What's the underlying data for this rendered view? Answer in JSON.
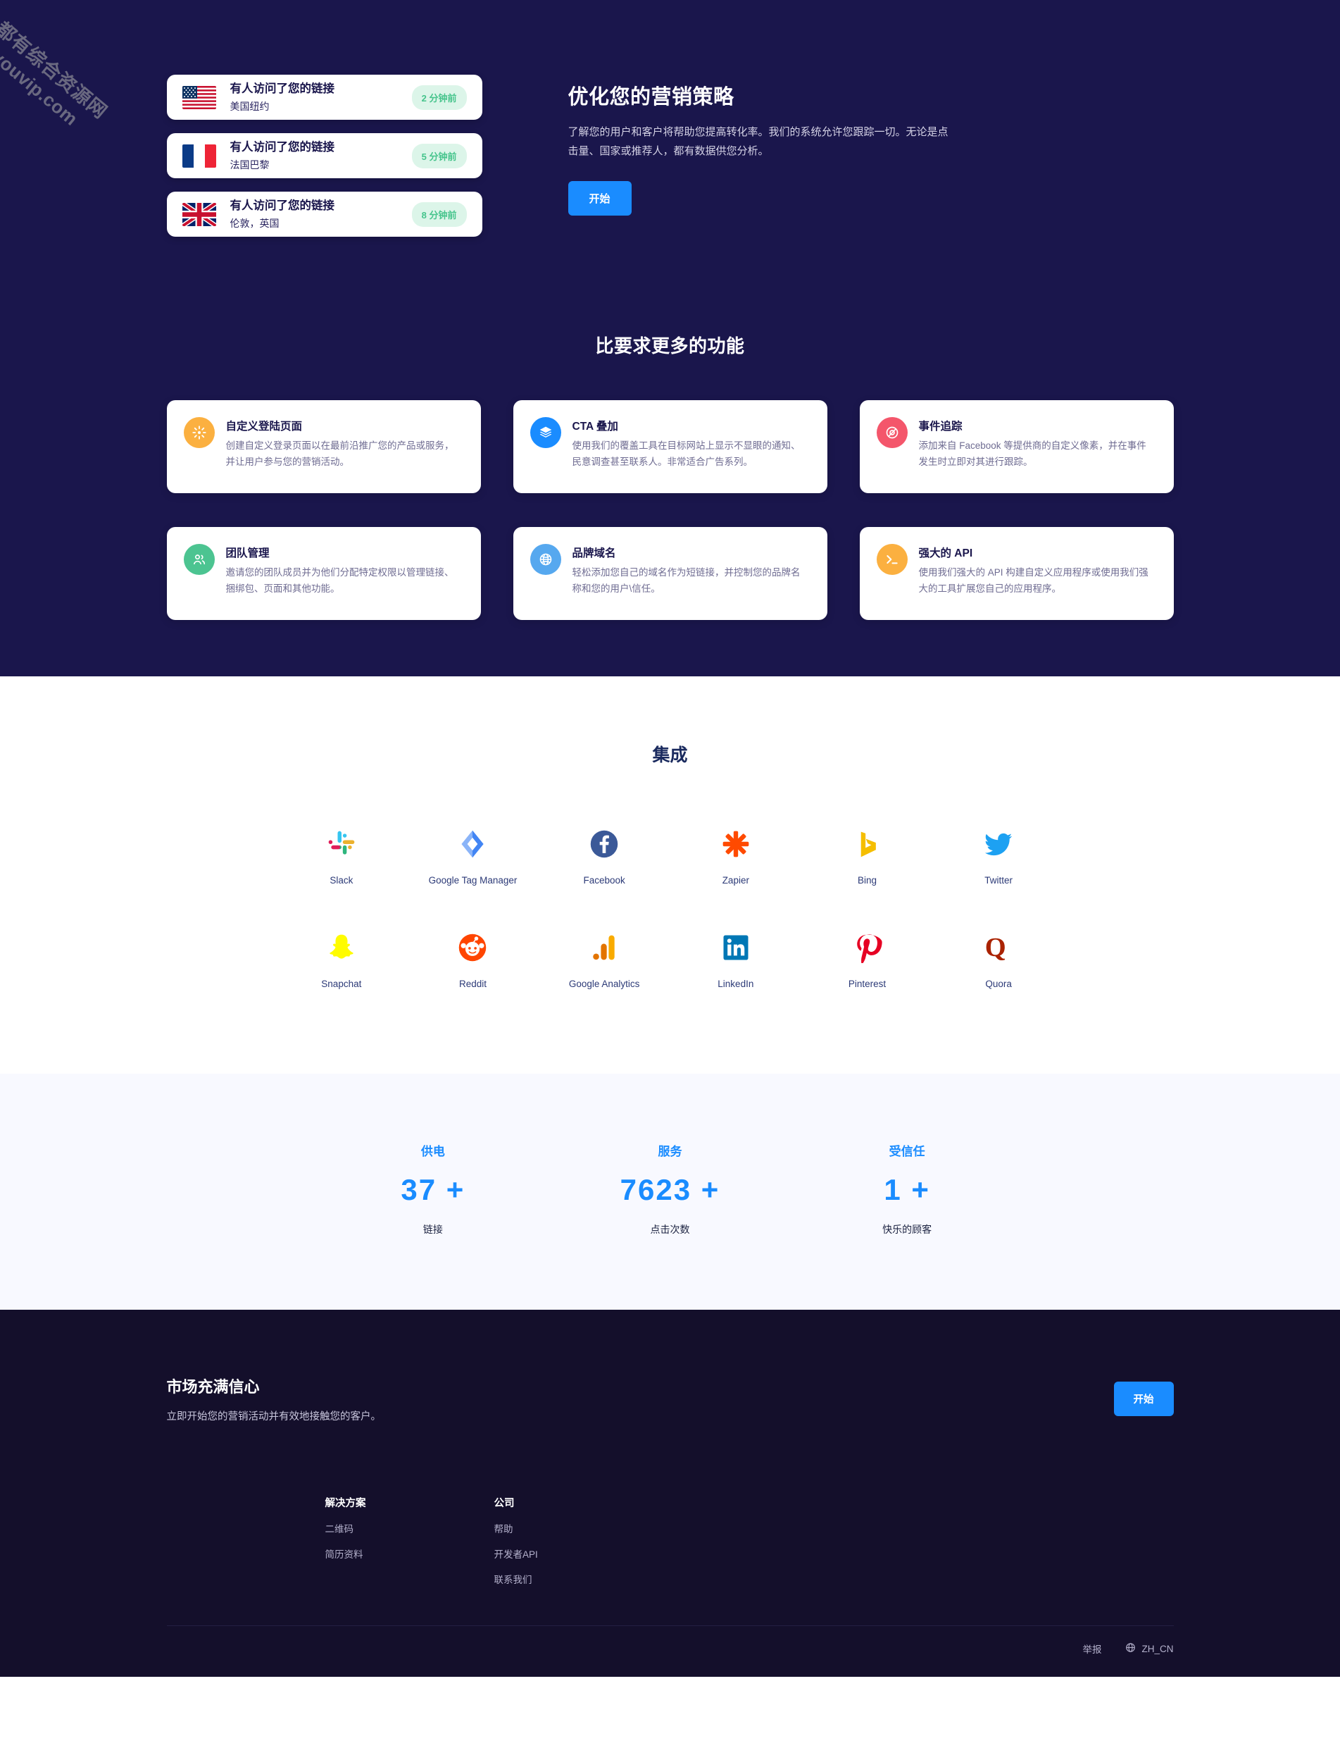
{
  "watermark": {
    "cn": "全都有综合资源网",
    "en": "douyouvip.com"
  },
  "hero": {
    "notifications": [
      {
        "flag": "us-flag",
        "title": "有人访问了您的链接",
        "location": "美国纽约",
        "time": "2 分钟前"
      },
      {
        "flag": "fr-flag",
        "title": "有人访问了您的链接",
        "location": "法国巴黎",
        "time": "5 分钟前"
      },
      {
        "flag": "gb-flag",
        "title": "有人访问了您的链接",
        "location": "伦敦，英国",
        "time": "8 分钟前"
      }
    ],
    "heading": "优化您的营销策略",
    "paragraph": "了解您的用户和客户将帮助您提高转化率。我们的系统允许您跟踪一切。无论是点击量、国家或推荐人，都有数据供您分析。",
    "cta_label": "开始"
  },
  "features": {
    "title": "比要求更多的功能",
    "cards": [
      {
        "icon": "sun-spinner-icon",
        "color": "#fbb040",
        "title": "自定义登陆页面",
        "desc": "创建自定义登录页面以在最前沿推广您的产品或服务，并让用户参与您的营销活动。"
      },
      {
        "icon": "layers-icon",
        "color": "#1a8cff",
        "title": "CTA 叠加",
        "desc": "使用我们的覆盖工具在目标网站上显示不显眼的通知、民意调查甚至联系人。非常适合广告系列。"
      },
      {
        "icon": "target-slash-icon",
        "color": "#f4566b",
        "title": "事件追踪",
        "desc": "添加来自 Facebook 等提供商的自定义像素，并在事件发生时立即对其进行跟踪。"
      },
      {
        "icon": "users-icon",
        "color": "#4cc491",
        "title": "团队管理",
        "desc": "邀请您的团队成员并为他们分配特定权限以管理链接、捆绑包、页面和其他功能。"
      },
      {
        "icon": "globe-icon",
        "color": "#56a8ef",
        "title": "品牌域名",
        "desc": "轻松添加您自己的域名作为短链接，并控制您的品牌名称和您的用户\\信任。"
      },
      {
        "icon": "terminal-icon",
        "color": "#fbb040",
        "title": "强大的 API",
        "desc": "使用我们强大的 API 构建自定义应用程序或使用我们强大的工具扩展您自己的应用程序。"
      }
    ]
  },
  "integrations": {
    "title": "集成",
    "items": [
      {
        "icon": "slack-icon",
        "label": "Slack"
      },
      {
        "icon": "google-tag-manager-icon",
        "label": "Google Tag Manager"
      },
      {
        "icon": "facebook-icon",
        "label": "Facebook"
      },
      {
        "icon": "zapier-icon",
        "label": "Zapier"
      },
      {
        "icon": "bing-icon",
        "label": "Bing"
      },
      {
        "icon": "twitter-icon",
        "label": "Twitter"
      },
      {
        "icon": "snapchat-icon",
        "label": "Snapchat"
      },
      {
        "icon": "reddit-icon",
        "label": "Reddit"
      },
      {
        "icon": "google-analytics-icon",
        "label": "Google Analytics"
      },
      {
        "icon": "linkedin-icon",
        "label": "LinkedIn"
      },
      {
        "icon": "pinterest-icon",
        "label": "Pinterest"
      },
      {
        "icon": "quora-icon",
        "label": "Quora"
      }
    ]
  },
  "stats": [
    {
      "label": "供电",
      "value": "37 +",
      "sub": "链接"
    },
    {
      "label": "服务",
      "value": "7623 +",
      "sub": "点击次数"
    },
    {
      "label": "受信任",
      "value": "1 +",
      "sub": "快乐的顾客"
    }
  ],
  "footer": {
    "cta_heading": "市场充满信心",
    "cta_text": "立即开始您的营销活动并有效地接触您的客户。",
    "cta_button": "开始",
    "columns": [
      {
        "head": "解决方案",
        "items": [
          "二维码",
          "简历资料"
        ]
      },
      {
        "head": "公司",
        "items": [
          "帮助",
          "开发者API",
          "联系我们"
        ]
      }
    ],
    "report_label": "举报",
    "language_label": "ZH_CN"
  },
  "colors": {
    "navy": "#1a164c",
    "footer_navy": "#140f2b",
    "accent_blue": "#1a8cff",
    "badge_bg": "#dcf5e9",
    "badge_text": "#46c48c",
    "stats_bg": "#f8f9ff"
  }
}
